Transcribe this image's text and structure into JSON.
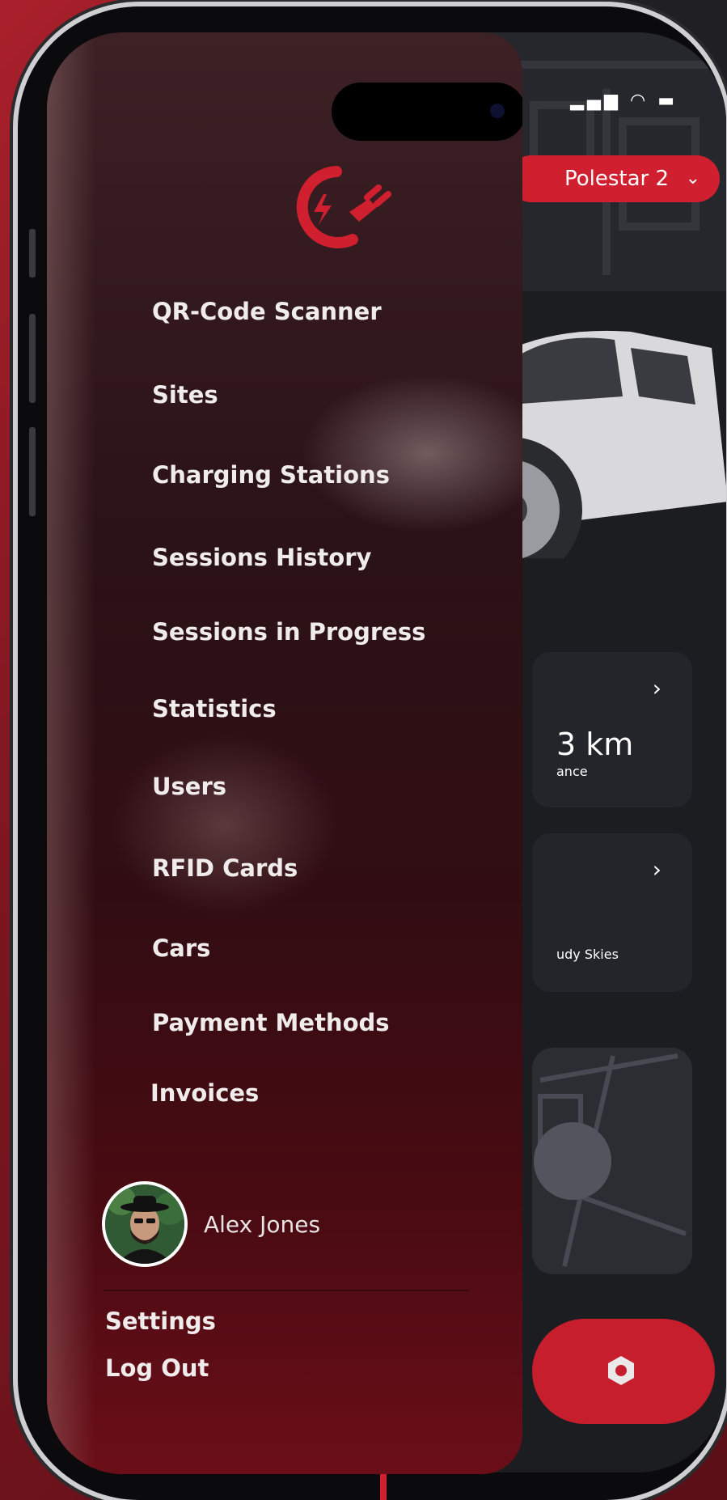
{
  "status_bar": {
    "signal_icon": "cellular-signal-icon",
    "wifi_icon": "wifi-icon",
    "battery_icon": "battery-icon"
  },
  "vehicle_selector": {
    "label": "Polestar 2",
    "chevron_icon": "chevron-down-icon"
  },
  "cards": {
    "range": {
      "value": "3 km",
      "label": "ance"
    },
    "weather": {
      "label": "udy Skies"
    }
  },
  "menu": {
    "items": [
      "QR-Code Scanner",
      "Sites",
      "Charging Stations",
      "Sessions History",
      "Sessions in Progress",
      "Statistics",
      "Users",
      "RFID Cards",
      "Cars",
      "Payment Methods",
      "Invoices"
    ]
  },
  "user": {
    "name": "Alex Jones"
  },
  "footer": {
    "settings": "Settings",
    "logout": "Log Out"
  },
  "colors": {
    "accent": "#d01f2e",
    "drawer_bottom": "#6b0e18",
    "card_bg": "#24252b"
  }
}
